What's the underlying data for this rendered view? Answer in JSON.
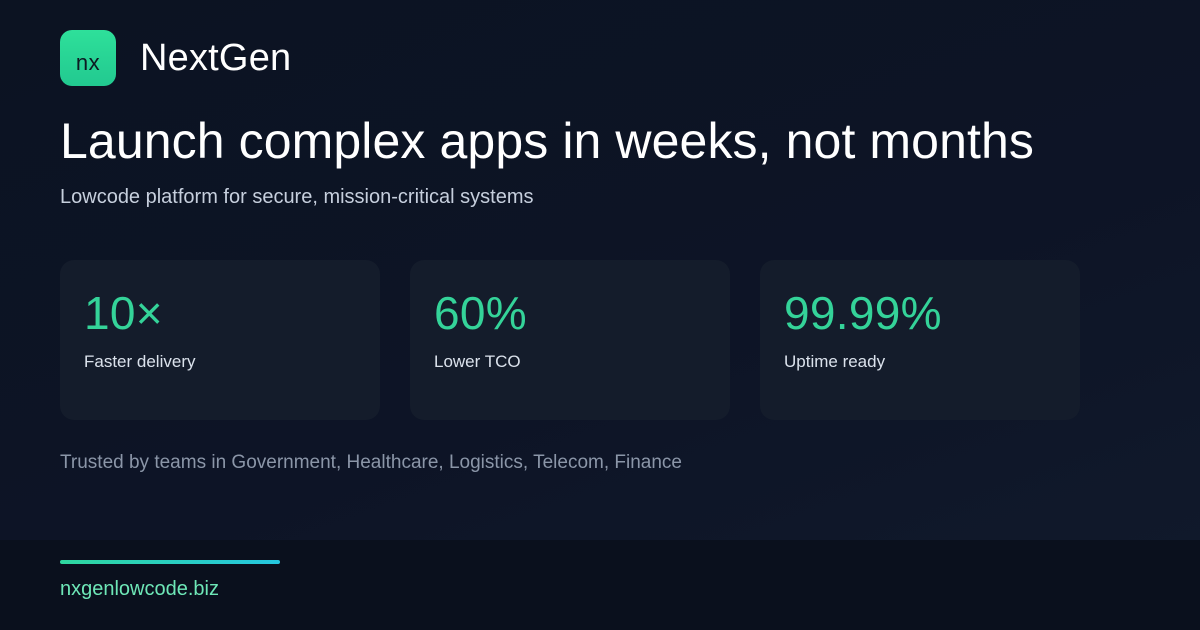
{
  "brand": {
    "logo_text": "nx",
    "name": "NextGen",
    "accent_color": "#34d399"
  },
  "hero": {
    "headline": "Launch complex apps in weeks, not months",
    "subhead": "Lowcode platform for secure, mission-critical systems"
  },
  "stats": [
    {
      "value": "10×",
      "label": "Faster delivery"
    },
    {
      "value": "60%",
      "label": "Lower TCO"
    },
    {
      "value": "99.99%",
      "label": "Uptime ready"
    }
  ],
  "trusted_text": "Trusted by teams in Government, Healthcare, Logistics, Telecom, Finance",
  "footer": {
    "url": "nxgenlowcode.biz"
  }
}
